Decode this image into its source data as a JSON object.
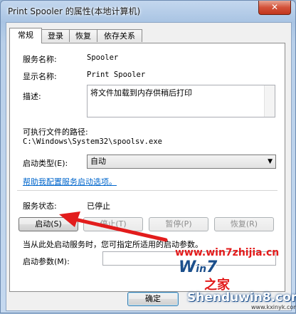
{
  "window": {
    "title": "Print Spooler 的属性(本地计算机)",
    "close_label": "✕"
  },
  "tabs": [
    {
      "label": "常规",
      "active": true
    },
    {
      "label": "登录",
      "active": false
    },
    {
      "label": "恢复",
      "active": false
    },
    {
      "label": "依存关系",
      "active": false
    }
  ],
  "general": {
    "service_name_label": "服务名称:",
    "service_name_value": "Spooler",
    "display_name_label": "显示名称:",
    "display_name_value": "Print Spooler",
    "description_label": "描述:",
    "description_value": "将文件加载到内存供稍后打印",
    "exe_path_label": "可执行文件的路径:",
    "exe_path_value": "C:\\Windows\\System32\\spoolsv.exe",
    "startup_type_label": "启动类型(E):",
    "startup_type_value": "自动",
    "help_link": "帮助我配置服务启动选项。",
    "status_label": "服务状态:",
    "status_value": "已停止",
    "buttons": {
      "start": "启动(S)",
      "stop": "停止(T)",
      "pause": "暂停(P)",
      "resume": "恢复(R)"
    },
    "hint_text": "当从此处启动服务时，您可指定所适用的启动参数。",
    "start_params_label": "启动参数(M):"
  },
  "footer": {
    "ok_label": "确定"
  },
  "watermark": {
    "url": "www.win7zhijia.cn",
    "brand": "Win7之家",
    "site": "Shenduwin8.com",
    "site2": "www.kxinyk.com"
  }
}
